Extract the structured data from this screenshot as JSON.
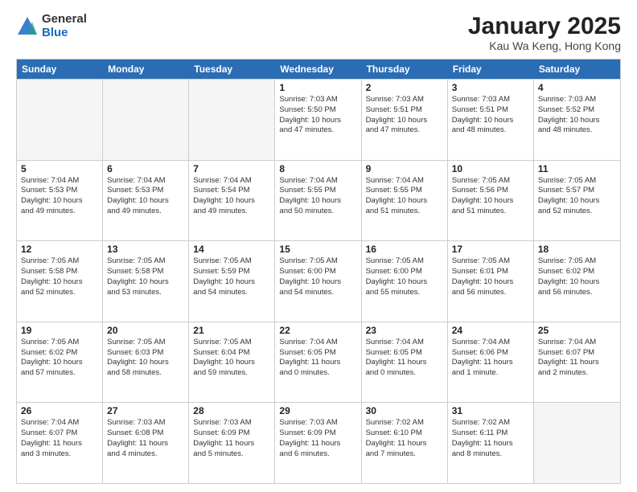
{
  "logo": {
    "general": "General",
    "blue": "Blue"
  },
  "title": "January 2025",
  "subtitle": "Kau Wa Keng, Hong Kong",
  "days": [
    "Sunday",
    "Monday",
    "Tuesday",
    "Wednesday",
    "Thursday",
    "Friday",
    "Saturday"
  ],
  "weeks": [
    [
      {
        "day": "",
        "info": ""
      },
      {
        "day": "",
        "info": ""
      },
      {
        "day": "",
        "info": ""
      },
      {
        "day": "1",
        "info": "Sunrise: 7:03 AM\nSunset: 5:50 PM\nDaylight: 10 hours\nand 47 minutes."
      },
      {
        "day": "2",
        "info": "Sunrise: 7:03 AM\nSunset: 5:51 PM\nDaylight: 10 hours\nand 47 minutes."
      },
      {
        "day": "3",
        "info": "Sunrise: 7:03 AM\nSunset: 5:51 PM\nDaylight: 10 hours\nand 48 minutes."
      },
      {
        "day": "4",
        "info": "Sunrise: 7:03 AM\nSunset: 5:52 PM\nDaylight: 10 hours\nand 48 minutes."
      }
    ],
    [
      {
        "day": "5",
        "info": "Sunrise: 7:04 AM\nSunset: 5:53 PM\nDaylight: 10 hours\nand 49 minutes."
      },
      {
        "day": "6",
        "info": "Sunrise: 7:04 AM\nSunset: 5:53 PM\nDaylight: 10 hours\nand 49 minutes."
      },
      {
        "day": "7",
        "info": "Sunrise: 7:04 AM\nSunset: 5:54 PM\nDaylight: 10 hours\nand 49 minutes."
      },
      {
        "day": "8",
        "info": "Sunrise: 7:04 AM\nSunset: 5:55 PM\nDaylight: 10 hours\nand 50 minutes."
      },
      {
        "day": "9",
        "info": "Sunrise: 7:04 AM\nSunset: 5:55 PM\nDaylight: 10 hours\nand 51 minutes."
      },
      {
        "day": "10",
        "info": "Sunrise: 7:05 AM\nSunset: 5:56 PM\nDaylight: 10 hours\nand 51 minutes."
      },
      {
        "day": "11",
        "info": "Sunrise: 7:05 AM\nSunset: 5:57 PM\nDaylight: 10 hours\nand 52 minutes."
      }
    ],
    [
      {
        "day": "12",
        "info": "Sunrise: 7:05 AM\nSunset: 5:58 PM\nDaylight: 10 hours\nand 52 minutes."
      },
      {
        "day": "13",
        "info": "Sunrise: 7:05 AM\nSunset: 5:58 PM\nDaylight: 10 hours\nand 53 minutes."
      },
      {
        "day": "14",
        "info": "Sunrise: 7:05 AM\nSunset: 5:59 PM\nDaylight: 10 hours\nand 54 minutes."
      },
      {
        "day": "15",
        "info": "Sunrise: 7:05 AM\nSunset: 6:00 PM\nDaylight: 10 hours\nand 54 minutes."
      },
      {
        "day": "16",
        "info": "Sunrise: 7:05 AM\nSunset: 6:00 PM\nDaylight: 10 hours\nand 55 minutes."
      },
      {
        "day": "17",
        "info": "Sunrise: 7:05 AM\nSunset: 6:01 PM\nDaylight: 10 hours\nand 56 minutes."
      },
      {
        "day": "18",
        "info": "Sunrise: 7:05 AM\nSunset: 6:02 PM\nDaylight: 10 hours\nand 56 minutes."
      }
    ],
    [
      {
        "day": "19",
        "info": "Sunrise: 7:05 AM\nSunset: 6:02 PM\nDaylight: 10 hours\nand 57 minutes."
      },
      {
        "day": "20",
        "info": "Sunrise: 7:05 AM\nSunset: 6:03 PM\nDaylight: 10 hours\nand 58 minutes."
      },
      {
        "day": "21",
        "info": "Sunrise: 7:05 AM\nSunset: 6:04 PM\nDaylight: 10 hours\nand 59 minutes."
      },
      {
        "day": "22",
        "info": "Sunrise: 7:04 AM\nSunset: 6:05 PM\nDaylight: 11 hours\nand 0 minutes."
      },
      {
        "day": "23",
        "info": "Sunrise: 7:04 AM\nSunset: 6:05 PM\nDaylight: 11 hours\nand 0 minutes."
      },
      {
        "day": "24",
        "info": "Sunrise: 7:04 AM\nSunset: 6:06 PM\nDaylight: 11 hours\nand 1 minute."
      },
      {
        "day": "25",
        "info": "Sunrise: 7:04 AM\nSunset: 6:07 PM\nDaylight: 11 hours\nand 2 minutes."
      }
    ],
    [
      {
        "day": "26",
        "info": "Sunrise: 7:04 AM\nSunset: 6:07 PM\nDaylight: 11 hours\nand 3 minutes."
      },
      {
        "day": "27",
        "info": "Sunrise: 7:03 AM\nSunset: 6:08 PM\nDaylight: 11 hours\nand 4 minutes."
      },
      {
        "day": "28",
        "info": "Sunrise: 7:03 AM\nSunset: 6:09 PM\nDaylight: 11 hours\nand 5 minutes."
      },
      {
        "day": "29",
        "info": "Sunrise: 7:03 AM\nSunset: 6:09 PM\nDaylight: 11 hours\nand 6 minutes."
      },
      {
        "day": "30",
        "info": "Sunrise: 7:02 AM\nSunset: 6:10 PM\nDaylight: 11 hours\nand 7 minutes."
      },
      {
        "day": "31",
        "info": "Sunrise: 7:02 AM\nSunset: 6:11 PM\nDaylight: 11 hours\nand 8 minutes."
      },
      {
        "day": "",
        "info": ""
      }
    ]
  ]
}
